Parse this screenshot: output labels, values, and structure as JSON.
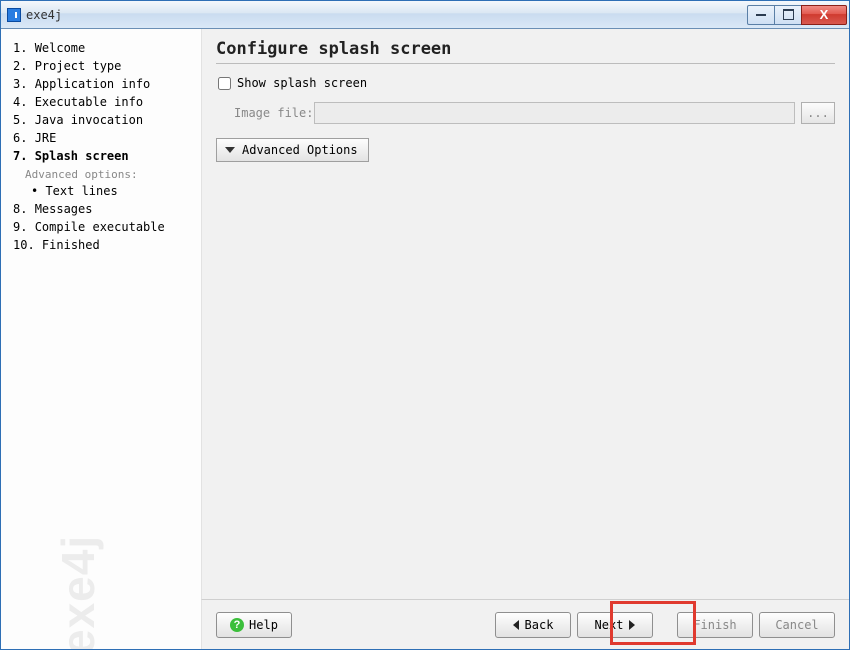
{
  "window": {
    "title": "exe4j"
  },
  "sidebar": {
    "items": [
      {
        "num": "1.",
        "label": "Welcome"
      },
      {
        "num": "2.",
        "label": "Project type"
      },
      {
        "num": "3.",
        "label": "Application info"
      },
      {
        "num": "4.",
        "label": "Executable info"
      },
      {
        "num": "5.",
        "label": "Java invocation"
      },
      {
        "num": "6.",
        "label": "JRE"
      },
      {
        "num": "7.",
        "label": "Splash screen",
        "current": true
      },
      {
        "num": "8.",
        "label": "Messages"
      },
      {
        "num": "9.",
        "label": "Compile executable"
      },
      {
        "num": "10.",
        "label": "Finished"
      }
    ],
    "sub_label": "Advanced options:",
    "sub_item": "Text lines",
    "watermark": "exe4j"
  },
  "main": {
    "title": "Configure splash screen",
    "show_splash_label": "Show splash screen",
    "show_splash_checked": false,
    "image_file_label": "Image file:",
    "image_file_value": "",
    "browse_label": "...",
    "advanced_label": "Advanced Options"
  },
  "footer": {
    "help": "Help",
    "back": "Back",
    "next": "Next",
    "finish": "Finish",
    "cancel": "Cancel"
  }
}
